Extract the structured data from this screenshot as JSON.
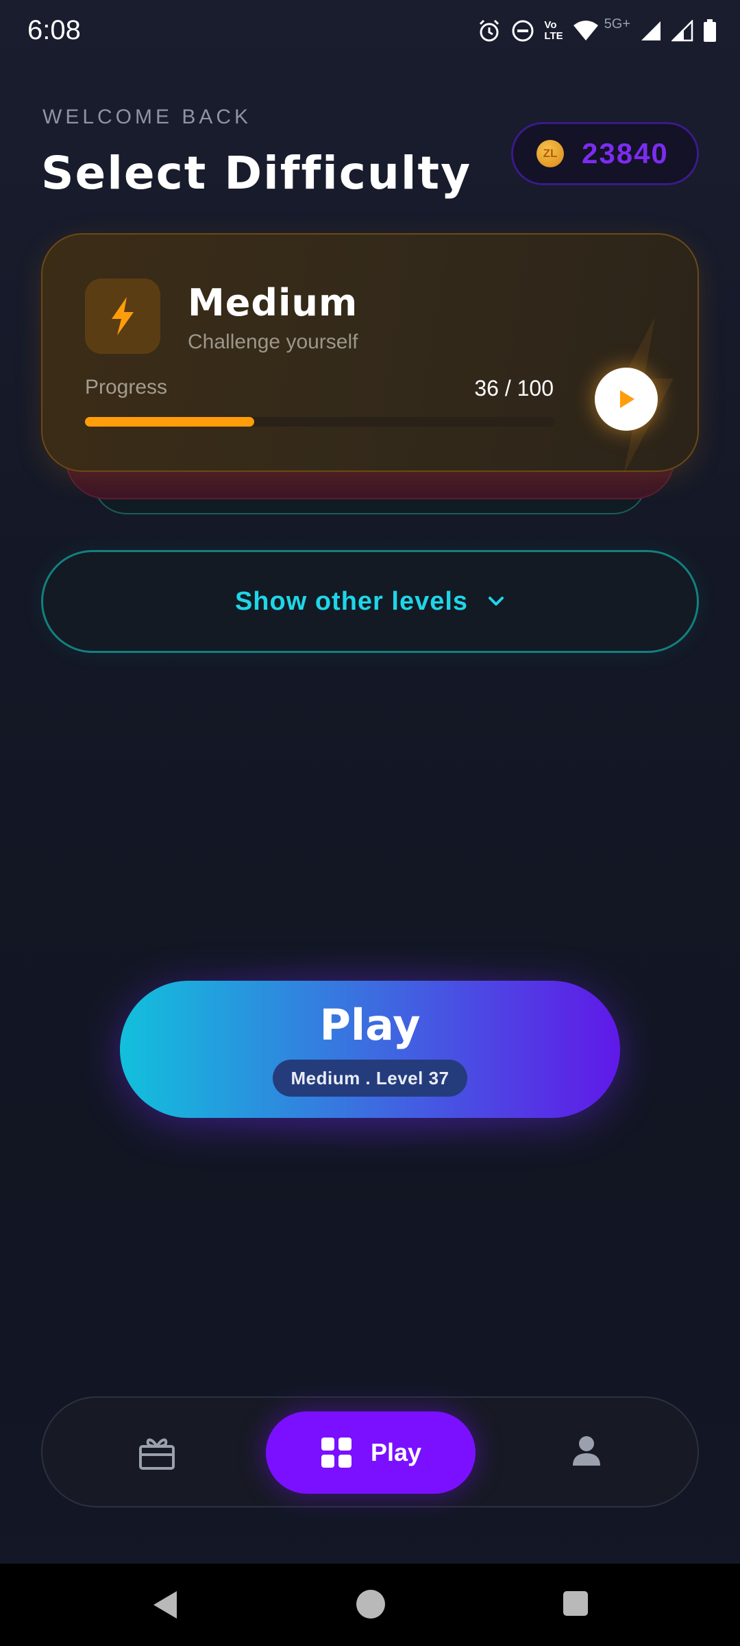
{
  "status_bar": {
    "time": "6:08",
    "network_badge_top": "Vo",
    "network_badge_bottom": "LTE",
    "network_type": "5G+"
  },
  "header": {
    "welcome": "WELCOME BACK",
    "title": "Select Difficulty",
    "coin_symbol": "ZL",
    "coin_balance": "23840"
  },
  "current_level": {
    "name": "Medium",
    "description": "Challenge yourself",
    "progress_label": "Progress",
    "progress_text": "36 / 100",
    "progress_fraction": 0.36,
    "accent_color": "#ff9d0a",
    "icon": "lightning-bolt-icon"
  },
  "show_levels": {
    "label": "Show other levels",
    "icon": "chevron-down-icon"
  },
  "play_button": {
    "label": "Play",
    "subtitle": "Medium . Level 37",
    "gradient_start": "#12c0dc",
    "gradient_end": "#6019e8"
  },
  "bottom_nav": {
    "items": [
      {
        "icon": "gift-icon",
        "label": "",
        "active": false
      },
      {
        "icon": "grid-icon",
        "label": "Play",
        "active": true
      },
      {
        "icon": "profile-icon",
        "label": "",
        "active": false
      }
    ],
    "active_color": "#7a10ff"
  }
}
